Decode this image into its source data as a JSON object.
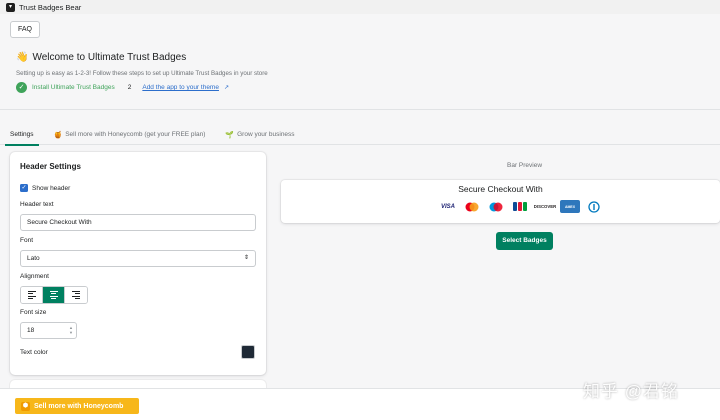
{
  "app": {
    "name": "Trust Badges Bear",
    "logo_icon": "bear-logo-icon"
  },
  "toolbar": {
    "faq_label": "FAQ"
  },
  "welcome": {
    "emoji": "👋",
    "title": "Welcome to Ultimate Trust Badges",
    "subtitle": "Setting up is easy as 1-2-3! Follow these steps to set up Ultimate Trust Badges in your store",
    "steps": [
      {
        "number": "✓",
        "label": "Install Ultimate Trust Badges",
        "done": true
      },
      {
        "number": "2",
        "label": "Add the app to your theme",
        "done": false,
        "link_icon": "external-link-icon"
      }
    ]
  },
  "tabs": [
    {
      "label": "Settings",
      "icon": "",
      "active": true
    },
    {
      "label": "Sell more with Honeycomb (get your FREE plan)",
      "icon": "🍯",
      "active": false
    },
    {
      "label": "Grow your business",
      "icon": "🌱",
      "active": false
    }
  ],
  "header_settings": {
    "title": "Header Settings",
    "show_header_label": "Show header",
    "show_header_checked": true,
    "header_text_label": "Header text",
    "header_text_value": "Secure Checkout With",
    "font_label": "Font",
    "font_value": "Lato",
    "alignment_label": "Alignment",
    "alignment_value": "center",
    "font_size_label": "Font size",
    "font_size_value": "18",
    "text_color_label": "Text color",
    "text_color_value": "#1f2a36"
  },
  "preview": {
    "label": "Bar Preview",
    "heading": "Secure Checkout With",
    "badges": [
      "VISA",
      "Mastercard",
      "Maestro",
      "JCB",
      "DISCOVER",
      "AMEX",
      "Diners Club"
    ],
    "select_button": "Select Badges"
  },
  "bottom": {
    "honeycomb_button": "Sell more with Honeycomb",
    "honeycomb_icon": "honeycomb-icon"
  },
  "watermark": "知乎 @君铭",
  "colors": {
    "primary": "#008060",
    "link": "#2c6ecb",
    "success": "#3fa35a",
    "honeycomb": "#f7b71a"
  }
}
